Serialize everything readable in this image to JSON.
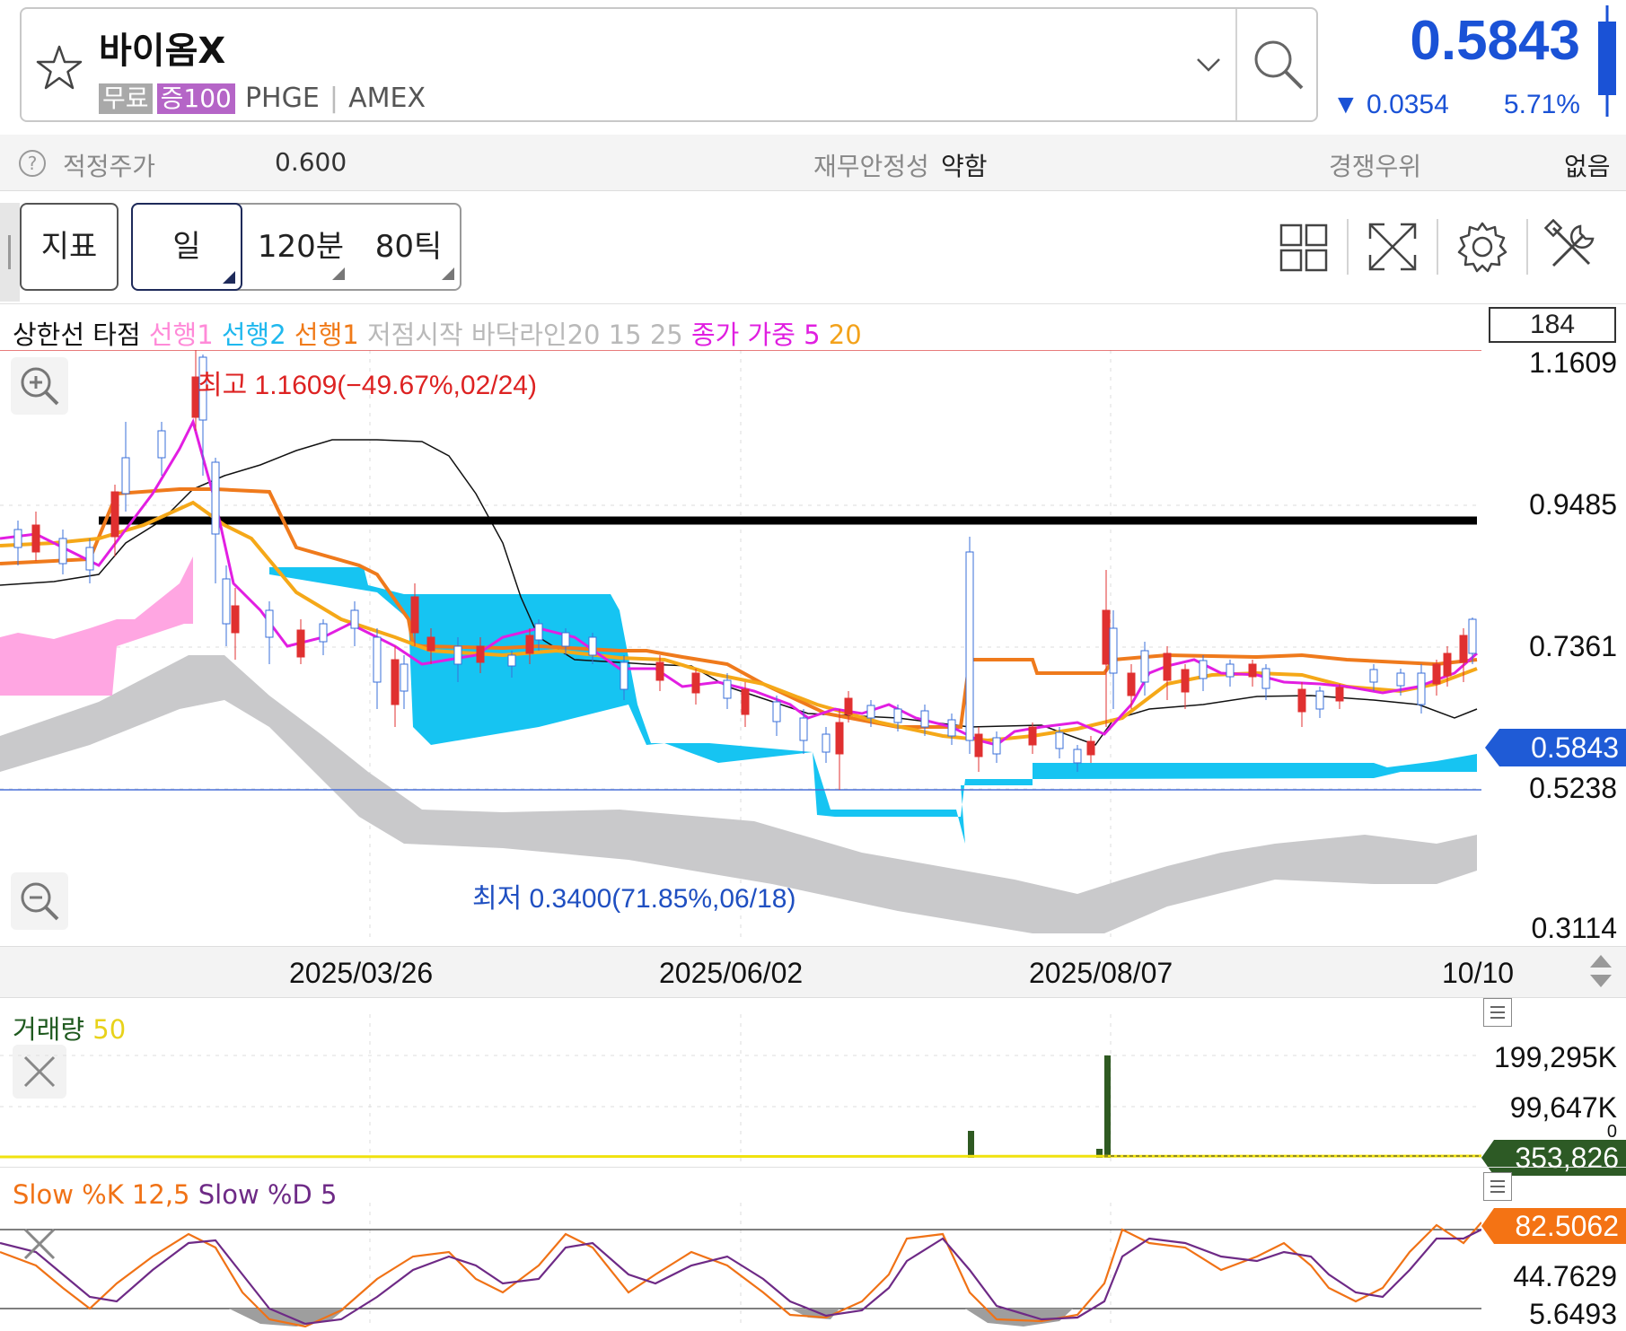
{
  "header": {
    "stock_name": "바이옴X",
    "tag_free": "무료",
    "tag_margin": "증100",
    "ticker": "PHGE",
    "exchange": "AMEX",
    "price": "0.5843",
    "change": "0.0354",
    "change_pct": "5.71%",
    "change_direction": "down",
    "price_color": "#1a52d6"
  },
  "info_bar": {
    "fair_price_label": "적정주가",
    "fair_price_value": "0.600",
    "stability_label": "재무안정성",
    "stability_value": "약함",
    "competitive_label": "경쟁우위",
    "competitive_value": "없음"
  },
  "toolbar": {
    "indicator_button": "지표",
    "period_day": "일",
    "period_120min": "120분",
    "period_80tick": "80틱",
    "icons": [
      "layout-grid-icon",
      "fullscreen-icon",
      "settings-gear-icon",
      "tools-icon"
    ]
  },
  "main_chart": {
    "legend": {
      "item1": "상한선 타점",
      "item2": "선행1",
      "item3": "선행2",
      "item4": "선행1",
      "item5": "저점시작 바닥라인20 15 25",
      "item6": "종가 가중 5",
      "item7": "20"
    },
    "legend_colors": {
      "item1": "#111111",
      "item2": "#ff8ad8",
      "item3": "#1fb8ee",
      "item4": "#f07a18",
      "item5": "#b9b9b9",
      "item6": "#e01fe0",
      "item7": "#f3a21b"
    },
    "count_box": "184",
    "high_note": "최고 1.1609(−49.67%,02/24)",
    "low_note": "최저 0.3400(71.85%,06/18)",
    "y_ticks": [
      "1.1609",
      "0.9485",
      "0.7361",
      "0.5238",
      "0.3114"
    ],
    "current_price_badge": "0.5843",
    "x_dates": [
      "2025/03/26",
      "2025/06/02",
      "2025/08/07",
      "10/10"
    ],
    "zoom_in_icon": "zoom-in-icon",
    "zoom_out_icon": "zoom-out-icon"
  },
  "volume_panel": {
    "label": "거래량",
    "period": "50",
    "y_ticks": [
      "199,295K",
      "99,647K",
      "0"
    ],
    "badge": "353,826"
  },
  "stoch_panel": {
    "label_k": "Slow %K 12,5",
    "label_d": "Slow %D 5",
    "y_ticks": [
      "44.7629",
      "5.6493"
    ],
    "badge": "82.5062"
  }
}
